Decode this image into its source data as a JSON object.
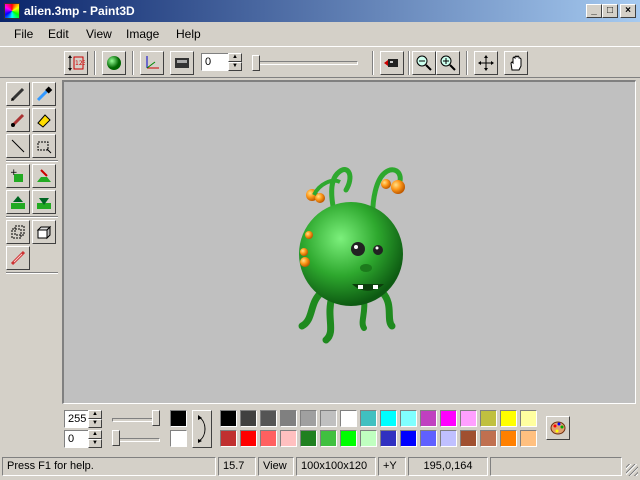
{
  "window": {
    "title": "alien.3mp - Paint3D",
    "controls": {
      "minimize": "_",
      "maximize": "□",
      "close": "×"
    }
  },
  "menu": [
    "File",
    "Edit",
    "View",
    "Image",
    "Help"
  ],
  "toolbar": {
    "frame_value": "0",
    "icons": [
      "resize-depth-icon",
      "sphere-icon",
      "axes-icon",
      "render-icon",
      "camera-icon",
      "zoom-out-icon",
      "zoom-in-icon",
      "move-icon",
      "hand-pan-icon"
    ]
  },
  "tools": [
    "pencil-icon",
    "eyedropper-icon",
    "brush-icon",
    "eraser-icon",
    "line-icon",
    "select-rect-icon",
    "add-voxel-icon",
    "extrude-icon",
    "raise-icon",
    "lower-icon",
    "select-3d-icon",
    "box-3d-icon",
    "stretch-icon"
  ],
  "color_panel": {
    "upper_value": "255",
    "lower_value": "0",
    "upper_slider_level": 1.0,
    "lower_slider_level": 0.0,
    "foreground_color": "#000000",
    "background_color": "#ffffff",
    "palette_row1": [
      "#000000",
      "#404040",
      "#555555",
      "#808080",
      "#a0a0a0",
      "#c0c0c0",
      "#ffffff",
      "#40c0c0",
      "#00ffff",
      "#80ffff",
      "#c040c0",
      "#ff00ff",
      "#ffa0ff",
      "#c0c040",
      "#ffff00",
      "#ffffa0"
    ],
    "palette_row2": [
      "#c03030",
      "#ff0000",
      "#ff6060",
      "#ffc0c0",
      "#208020",
      "#40c040",
      "#00ff00",
      "#c0ffc0",
      "#3030c0",
      "#0000ff",
      "#6060ff",
      "#c0c0ff",
      "#a05030",
      "#c07050",
      "#ff8000",
      "#ffc080"
    ]
  },
  "status": {
    "help": "Press F1 for help.",
    "zoom": "15.7",
    "mode": "View",
    "dimensions": "100x100x120",
    "axis": "+Y",
    "coords": "195,0,164"
  },
  "colors": {
    "titlebar_start": "#0a246a",
    "titlebar_end": "#a6caf0",
    "face": "#d4d0c8",
    "canvas": "#c0c0c0",
    "alien_green": "#2ea82e",
    "antenna_orange": "#ff9a1a"
  }
}
